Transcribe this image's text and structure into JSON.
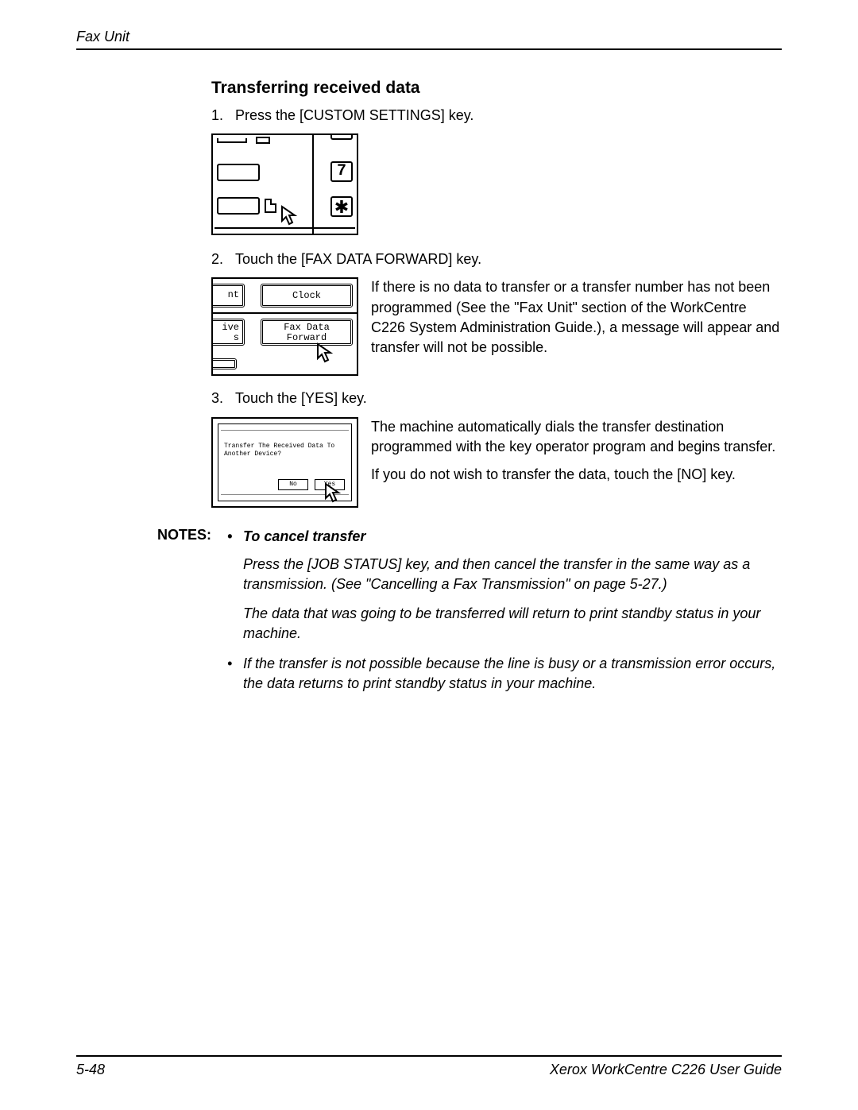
{
  "header": {
    "running_head": "Fax Unit"
  },
  "heading": "Transferring received data",
  "step1": {
    "num": "1.",
    "text": "Press the [CUSTOM SETTINGS] key."
  },
  "fig1": {
    "seven": "7",
    "star": "✱"
  },
  "step2": {
    "num": "2.",
    "text": "Touch the [FAX DATA FORWARD] key."
  },
  "fig2": {
    "btn_left1": "nt",
    "btn_right1": "Clock",
    "btn_left2": "ive\ns",
    "btn_right2": "Fax Data\nForward"
  },
  "step2_side": "If there is no data to transfer or a transfer number has not been programmed (See the \"Fax Unit\" section of the WorkCentre C226 System Administration Guide.), a message will appear and transfer will not be possible.",
  "step3": {
    "num": "3.",
    "text": "Touch the [YES] key."
  },
  "fig3": {
    "dialog": "Transfer The Received Data To Another Device?",
    "no": "No",
    "yes": "Yes"
  },
  "step3_side_p1": "The machine automatically dials the transfer destination programmed with the key operator program and begins transfer.",
  "step3_side_p2": "If you do not wish to transfer the data, touch the [NO] key.",
  "notes": {
    "label": "NOTES:",
    "bullet1_title": "To cancel transfer",
    "bullet1_p1": "Press the [JOB STATUS] key, and then cancel the transfer in the same way as a transmission. (See \"Cancelling a Fax Transmission\" on page 5-27.)",
    "bullet1_p2": "The data that was going to be transferred will return to print standby status in your machine.",
    "bullet2": "If the transfer is not possible because the line is busy or a transmission error occurs, the data returns to print standby status in your machine."
  },
  "footer": {
    "page": "5-48",
    "guide": "Xerox WorkCentre C226 User Guide"
  }
}
